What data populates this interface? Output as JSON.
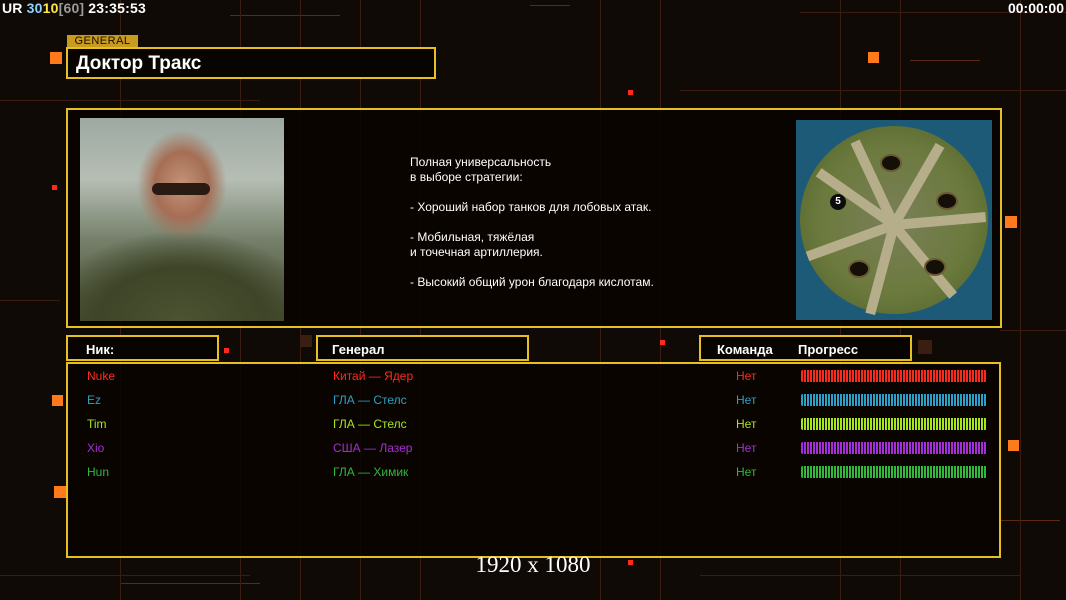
{
  "hud": {
    "left": [
      {
        "text": "UR",
        "color": "#ffffff"
      },
      {
        "text": "30",
        "color": "#8fd3ff"
      },
      {
        "text": "10",
        "color": "#ffe94a"
      },
      {
        "text": "[60]",
        "color": "#9a9a9a"
      },
      {
        "text": "23:35:53",
        "color": "#ffffff"
      }
    ],
    "right": "00:00:00"
  },
  "general": {
    "tag": "GENERAL",
    "name": "Доктор Тракс",
    "description": "Полная универсальность\nв выборе стратегии:\n\n- Хороший набор танков для лобовых атак.\n\n- Мобильная, тяжёлая\nи точечная артиллерия.\n\n- Высокий общий урон благодаря кислотам."
  },
  "minimap": {
    "player_marker": "5"
  },
  "table": {
    "headers": {
      "nick": "Ник:",
      "general": "Генерал",
      "team": "Команда",
      "progress": "Прогресс"
    },
    "rows": [
      {
        "nick": "Nuke",
        "general": "Китай — Ядер",
        "team": "Нет",
        "color": "#ff2a1e"
      },
      {
        "nick": "Ez",
        "general": "ГЛА — Стелс",
        "team": "Нет",
        "color": "#2aa0c8"
      },
      {
        "nick": "Tim",
        "general": "ГЛА — Стелс",
        "team": "Нет",
        "color": "#a7e61f"
      },
      {
        "nick": "Xio",
        "general": "США — Лазер",
        "team": "Нет",
        "color": "#a52fd6"
      },
      {
        "nick": "Hun",
        "general": "ГЛА — Химик",
        "team": "Нет",
        "color": "#2fb83a"
      }
    ]
  },
  "footer": {
    "resolution": "1920 x 1080"
  }
}
